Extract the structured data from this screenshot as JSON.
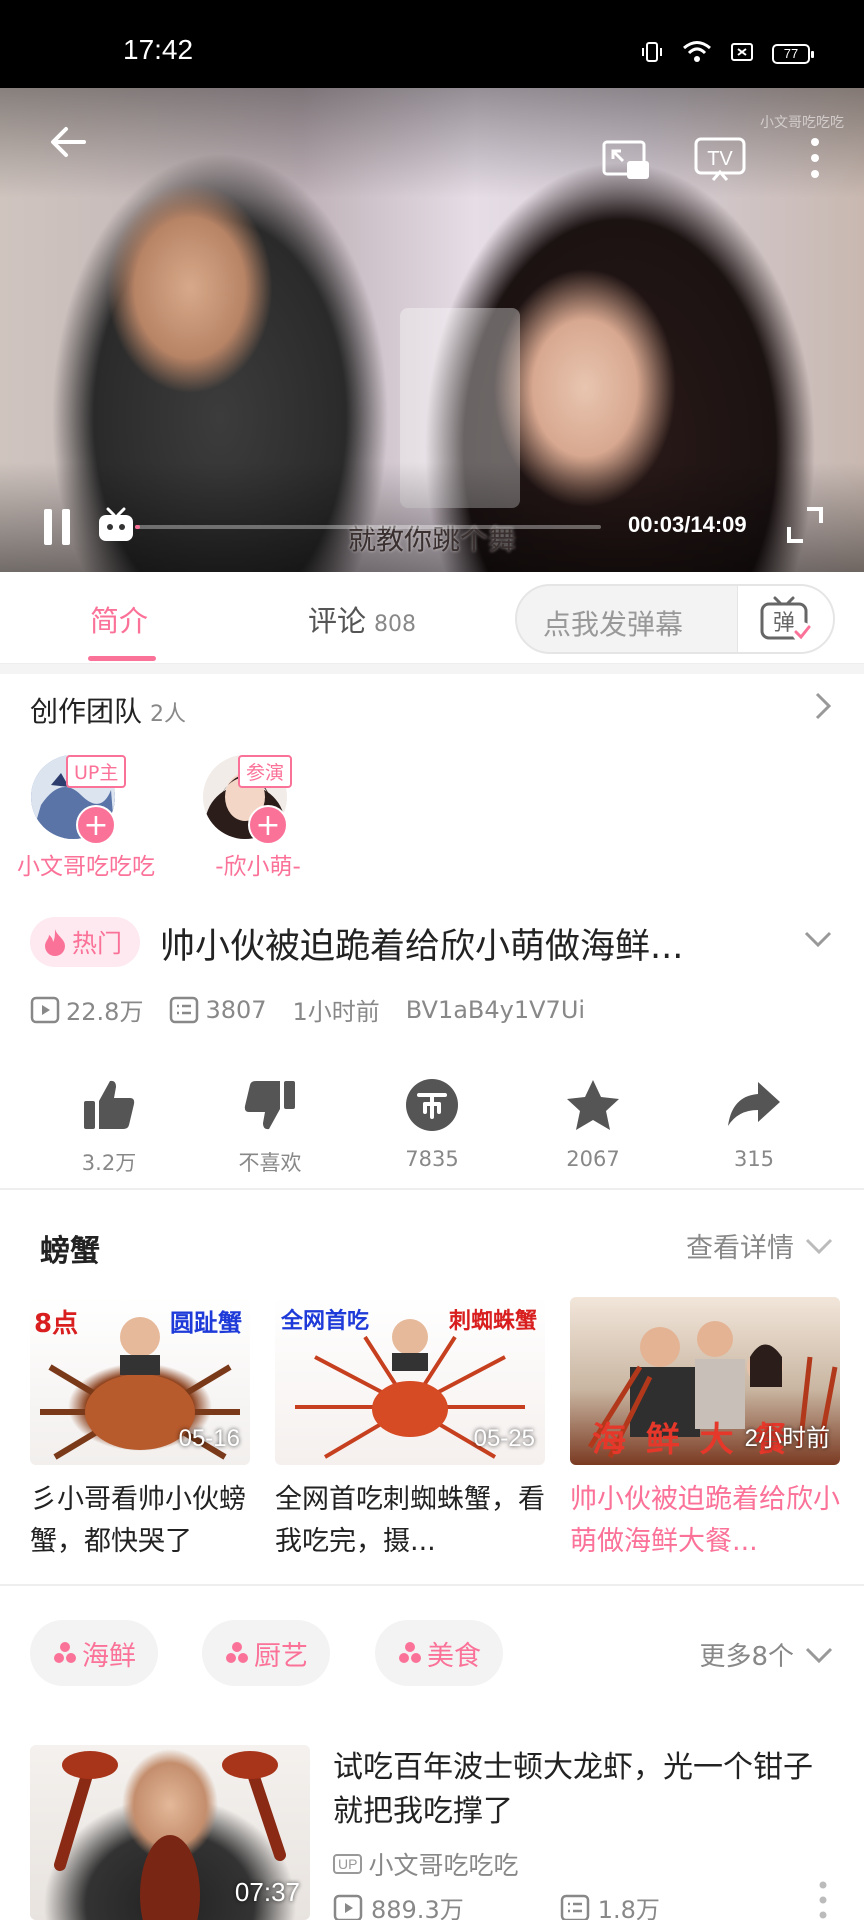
{
  "status_bar": {
    "time": "17:42",
    "battery": "77"
  },
  "player": {
    "watermark": "小文哥吃吃吃",
    "subtitle": "就教你跳个舞",
    "time_display": "00:03/14:09",
    "progress": 0.0035
  },
  "tabs": {
    "intro_label": "简介",
    "comments_label": "评论",
    "comments_count": "808",
    "danmaku_placeholder": "点我发弹幕",
    "danmaku_button": "弹"
  },
  "team": {
    "title": "创作团队",
    "count": "2人",
    "members": [
      {
        "role": "UP主",
        "name": "小文哥吃吃吃"
      },
      {
        "role": "参演",
        "name": "-欣小萌-"
      }
    ]
  },
  "video": {
    "hot_tag": "热门",
    "title": "帅小伙被迫跪着给欣小萌做海鲜...",
    "views": "22.8万",
    "danmaku": "3807",
    "time_ago": "1小时前",
    "bvid": "BV1aB4y1V7Ui"
  },
  "actions": {
    "like": "3.2万",
    "dislike": "不喜欢",
    "coin": "7835",
    "favorite": "2067",
    "share": "315"
  },
  "series": {
    "title": "螃蟹",
    "more": "查看详情",
    "cards": [
      {
        "title": "彡小哥看帅小伙螃蟹，都快哭了",
        "badge": "05-16",
        "overlay_left": "8点",
        "overlay_right": "圆趾蟹"
      },
      {
        "title": "全网首吃刺蜘蛛蟹，看我吃完，摄...",
        "badge": "05-25",
        "overlay_left": "全网首吃",
        "overlay_right": "刺蜘蛛蟹"
      },
      {
        "title": "帅小伙被迫跪着给欣小萌做海鲜大餐...",
        "badge": "2小时前",
        "overlay_left": "海 鲜 大 餐",
        "overlay_right": ""
      }
    ]
  },
  "tags": {
    "items": [
      "海鲜",
      "厨艺",
      "美食"
    ],
    "more": "更多8个"
  },
  "related": {
    "title": "试吃百年波士顿大龙虾，光一个钳子就把我吃撑了",
    "duration": "07:37",
    "up_badge": "UP",
    "up_name": "小文哥吃吃吃",
    "views": "889.3万",
    "danmaku": "1.8万"
  },
  "colors": {
    "accent": "#fb7299",
    "muted": "#888888"
  }
}
